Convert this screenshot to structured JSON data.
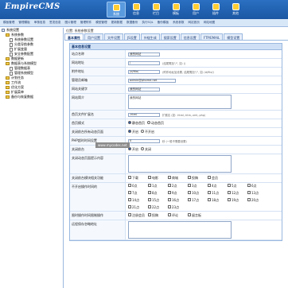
{
  "app": {
    "logo": "EmpireCMS"
  },
  "nav": [
    {
      "label": "系统",
      "active": true
    },
    {
      "label": "信息"
    },
    {
      "label": "栏目"
    },
    {
      "label": "模板"
    },
    {
      "label": "用户"
    },
    {
      "label": "插件"
    },
    {
      "label": "其他"
    }
  ],
  "submenu": [
    "模板管理",
    "管理模板",
    "审核信息",
    "签发信息",
    "图片管理",
    "管理附件",
    "模型管理",
    "更新数据",
    "数据备份",
    "执行SQL",
    "备份模板",
    "系统参数",
    "网站首页",
    "网站地图"
  ],
  "tree": [
    {
      "label": "系统设置",
      "level": 0,
      "kind": "tree"
    },
    {
      "label": "系统参数",
      "level": 1,
      "kind": "folder"
    },
    {
      "label": "系统参数设置",
      "level": 2,
      "kind": "file"
    },
    {
      "label": "分类导航参数",
      "level": 2,
      "kind": "file"
    },
    {
      "label": "扩展变量",
      "level": 2,
      "kind": "file"
    },
    {
      "label": "安全参数配置",
      "level": 2,
      "kind": "file"
    },
    {
      "label": "数据更新",
      "level": 1,
      "kind": "folder"
    },
    {
      "label": "数据表与系统模型",
      "level": 1,
      "kind": "folder"
    },
    {
      "label": "管理数据表",
      "level": 2,
      "kind": "file"
    },
    {
      "label": "管理系统模型",
      "level": 2,
      "kind": "file"
    },
    {
      "label": "计划任务",
      "level": 1,
      "kind": "folder"
    },
    {
      "label": "工作流",
      "level": 1,
      "kind": "folder"
    },
    {
      "label": "优化方案",
      "level": 1,
      "kind": "folder"
    },
    {
      "label": "扩展菜单",
      "level": 1,
      "kind": "folder"
    },
    {
      "label": "备份与恢复数据",
      "level": 1,
      "kind": "folder"
    }
  ],
  "main": {
    "breadcrumb": "位置: 系统参数设置",
    "tabs": [
      "基本属性",
      "用户设置",
      "文件设置",
      "JS设置",
      "外链生成",
      "搜索设置",
      "信息设置",
      "FTP/EMAIL",
      "模型设置"
    ],
    "form_title": "基本信息设置",
    "rows": [
      {
        "label": "站点名称",
        "value": "我的网站",
        "type": "input"
      },
      {
        "label": "网站地址",
        "value": "/",
        "hint": "(结尾需加\"/\", 如: /)",
        "type": "input"
      },
      {
        "label": "附件地址",
        "value": "/d/file/",
        "hint": "(附件地址加设置, 结尾需加\"/\", 如: /d/file/)",
        "type": "input"
      },
      {
        "label": "管理员邮箱",
        "value": "admin@phome.net",
        "type": "input"
      },
      {
        "label": "网站关键字",
        "value": "我的网站",
        "type": "input"
      },
      {
        "label": "网站简介",
        "value": "我的网站",
        "type": "textarea"
      },
      {
        "label": "首页文件扩展名",
        "value": ".html",
        "hint": "扩展名 (如: .html,.htm,.xml,.php)",
        "type": "input"
      },
      {
        "label": "首页模式",
        "options": [
          "静态首页",
          "动态首页"
        ],
        "type": "radio"
      },
      {
        "label": "关闭前台所有动态页面",
        "options": [
          "开启",
          "不开启"
        ],
        "type": "radio"
      },
      {
        "label": "PHP超时时间设置",
        "value": "0",
        "hint": "秒 (一般不需要设置)",
        "type": "input"
      },
      {
        "label": "关闭前台",
        "options": [
          "开启",
          "关闭"
        ],
        "type": "radio"
      },
      {
        "label": "关闭动态页面提示内容",
        "value": "",
        "type": "textarea"
      },
      {
        "label": "关闭前台模块相关功能",
        "options": [
          "下载",
          "电影",
          "商城",
          "投稿",
          "会员"
        ],
        "type": "check"
      },
      {
        "label": "不开启操作时间的",
        "options": [
          "0点",
          "1点",
          "2点",
          "3点",
          "4点",
          "5点",
          "6点",
          "7点",
          "8点",
          "9点",
          "10点",
          "11点",
          "12点",
          "13点",
          "14点",
          "15点",
          "16点",
          "17点",
          "18点",
          "19点",
          "20点",
          "21点",
          "22点",
          "23点"
        ],
        "type": "check"
      },
      {
        "label": "限时操作时间限制操作",
        "options": [
          "注册会员",
          "投稿",
          "评论",
          "留言板"
        ],
        "type": "check"
      },
      {
        "label": "远程保存忽略地址",
        "value": "",
        "type": "textarea"
      }
    ]
  },
  "overlay": "www.mycodes.net"
}
